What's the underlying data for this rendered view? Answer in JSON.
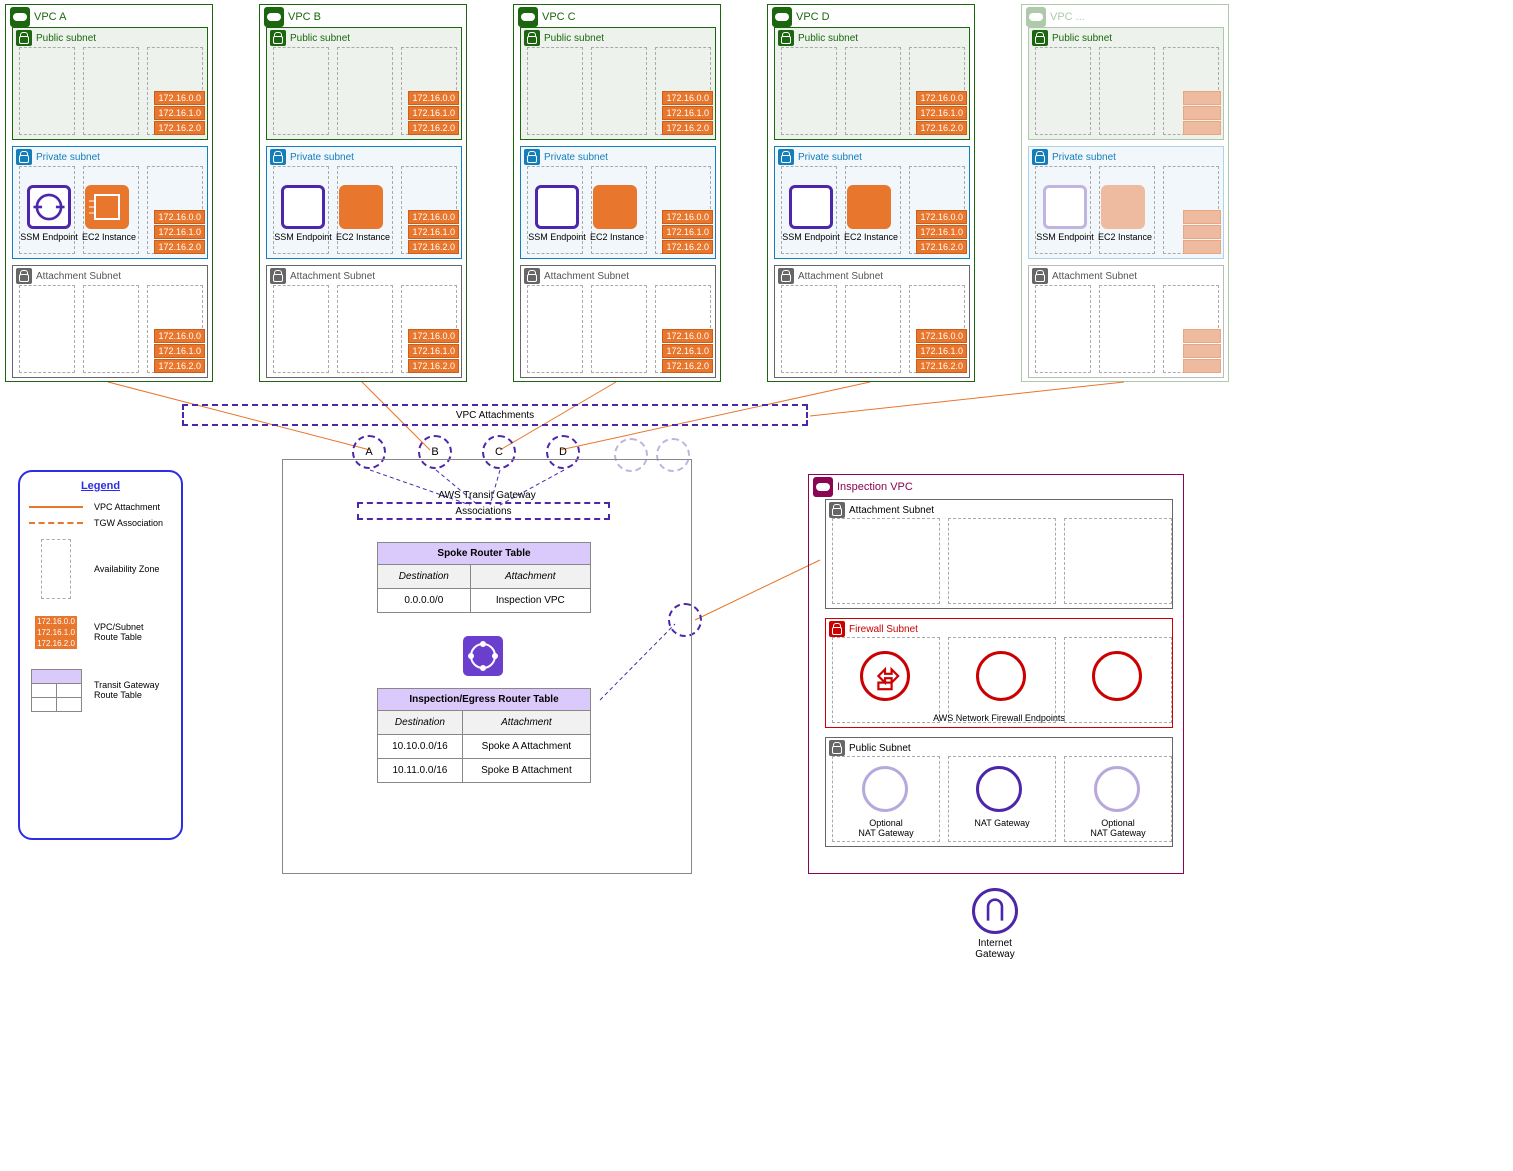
{
  "vpc_list": [
    "VPC A",
    "VPC B",
    "VPC C",
    "VPC D",
    "VPC ..."
  ],
  "subnet_labels": {
    "public": "Public subnet",
    "private": "Private subnet",
    "attachment": "Attachment Subnet"
  },
  "route_ips": [
    "172.16.0.0",
    "172.16.1.0",
    "172.16.2.0"
  ],
  "res_labels": {
    "ssm": "SSM Endpoint",
    "ec2": "EC2 Instance"
  },
  "attach_bar": "VPC Attachments",
  "tgw": {
    "title": "AWS Transit Gateway",
    "assoc": "Associations",
    "circles": [
      "A",
      "B",
      "C",
      "D"
    ],
    "spoke": {
      "title": "Spoke Router Table",
      "hdr": [
        "Destination",
        "Attachment"
      ],
      "rows": [
        [
          "0.0.0.0/0",
          "Inspection VPC"
        ]
      ]
    },
    "egress": {
      "title": "Inspection/Egress Router Table",
      "hdr": [
        "Destination",
        "Attachment"
      ],
      "rows": [
        [
          "10.10.0.0/16",
          "Spoke A Attachment"
        ],
        [
          "10.11.0.0/16",
          "Spoke B Attachment"
        ]
      ]
    }
  },
  "legend": {
    "title": "Legend",
    "items": [
      {
        "label": "VPC Attachment"
      },
      {
        "label": "TGW Association"
      },
      {
        "label": "Availability Zone"
      },
      {
        "label": "VPC/Subnet\nRoute Table"
      },
      {
        "label": "Transit Gateway\nRoute Table"
      }
    ]
  },
  "inspection": {
    "title": "Inspection VPC",
    "att": "Attachment Subnet",
    "fw": "Firewall Subnet",
    "pub": "Public Subnet",
    "fw_label": "AWS Network Firewall Endpoints",
    "nat": "NAT Gateway",
    "nat_opt": "Optional\nNAT Gateway"
  },
  "igw": "Internet Gateway"
}
